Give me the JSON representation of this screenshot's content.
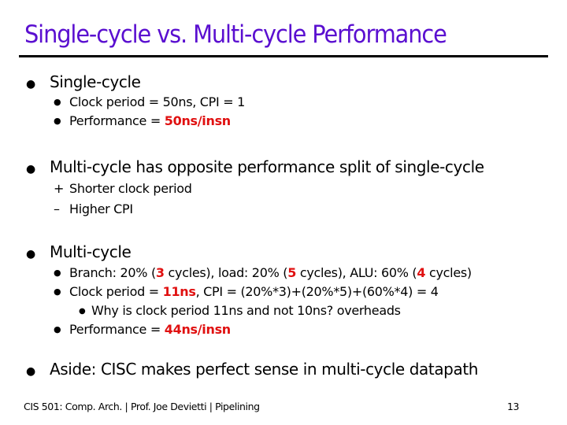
{
  "title": "Single-cycle vs. Multi-cycle Performance",
  "bullets": {
    "single": {
      "label": "Single-cycle",
      "items": [
        {
          "text": "Clock period = 50ns, CPI = 1"
        },
        {
          "pre": "Performance = ",
          "emph": "50ns/insn"
        }
      ]
    },
    "split": {
      "label": "Multi-cycle has opposite performance split of single-cycle",
      "items": [
        {
          "marker": "+",
          "text": "Shorter clock period"
        },
        {
          "marker": "–",
          "text": "Higher CPI"
        }
      ]
    },
    "multi": {
      "label": "Multi-cycle",
      "branch": {
        "p1": "Branch: 20% (",
        "v1": "3",
        "p2": " cycles), load: 20% (",
        "v2": "5",
        "p3": " cycles), ALU: 60% (",
        "v3": "4",
        "p4": " cycles)"
      },
      "clock": {
        "pre": "Clock period = ",
        "emph": "11ns",
        "post": ", CPI = (20%*3)+(20%*5)+(60%*4) = 4"
      },
      "why": "Why is clock period 11ns and not 10ns?  overheads",
      "perf": {
        "pre": "Performance = ",
        "emph": "44ns/insn"
      }
    },
    "aside": {
      "label": "Aside: CISC makes perfect sense in multi-cycle datapath"
    }
  },
  "footer": {
    "left": "CIS 501: Comp. Arch.  |  Prof. Joe Devietti  |  Pipelining",
    "page": "13"
  }
}
